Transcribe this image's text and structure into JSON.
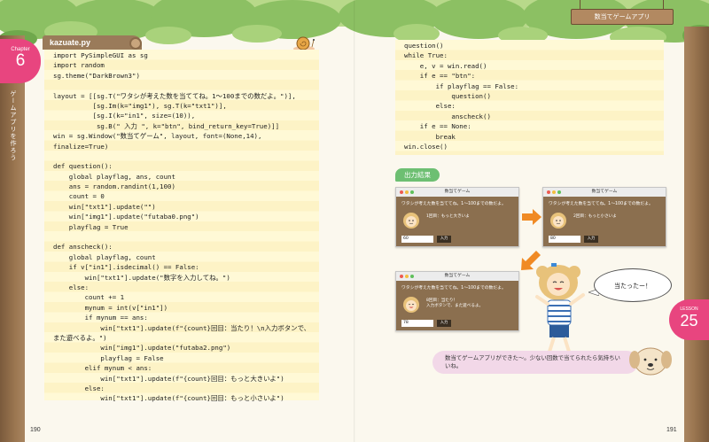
{
  "header": {
    "sign": "数当てゲームアプリ"
  },
  "chapter": {
    "word": "Chapter",
    "number": "6",
    "vertical": "ゲームアプリを作ろう"
  },
  "lesson": {
    "word": "LESSON",
    "number": "25"
  },
  "listing": {
    "filename": "kazuate.py",
    "left_lines": [
      "import PySimpleGUI as sg",
      "import random",
      "sg.theme(\"DarkBrown3\")",
      "",
      "layout = [[sg.T(\"ワタシが考えた数を当ててね。1〜100までの数だよ。\")],",
      "          [sg.Im(k=\"img1\"), sg.T(k=\"txt1\")],",
      "          [sg.I(k=\"in1\", size=(10)),",
      "           sg.B(\" 入力 \", k=\"btn\", bind_return_key=True)]]",
      "win = sg.Window(\"数当てゲーム\", layout, font=(None,14),",
      "finalize=True)",
      "",
      "def question():",
      "    global playflag, ans, count",
      "    ans = random.randint(1,100)",
      "    count = 0",
      "    win[\"txt1\"].update(\"\")",
      "    win[\"img1\"].update(\"futaba0.png\")",
      "    playflag = True",
      "",
      "def anscheck():",
      "    global playflag, count",
      "    if v[\"in1\"].isdecimal() == False:",
      "        win[\"txt1\"].update(\"数字を入力してね。\")",
      "    else:",
      "        count += 1",
      "        mynum = int(v[\"in1\"])",
      "        if mynum == ans:",
      "            win[\"txt1\"].update(f\"{count}回目：当たり！\\n入力ボタンで、",
      "また遊べるよ。\")",
      "            win[\"img1\"].update(\"futaba2.png\")",
      "            playflag = False",
      "        elif mynum < ans:",
      "            win[\"txt1\"].update(f\"{count}回目：もっと大きいよ\")",
      "        else:",
      "            win[\"txt1\"].update(f\"{count}回目：もっと小さいよ\")"
    ],
    "right_lines": [
      "question()",
      "while True:",
      "    e, v = win.read()",
      "    if e == \"btn\":",
      "        if playflag == False:",
      "            question()",
      "        else:",
      "            anscheck()",
      "    if e == None:",
      "        break",
      "win.close()"
    ]
  },
  "pages": {
    "left": "190",
    "right": "191"
  },
  "output": {
    "label": "出力結果",
    "windows": [
      {
        "title": "数当てゲーム",
        "prompt": "ワタシが考えた数を当ててね。1〜100までの数だよ。",
        "message": "1回目：もっと大きいよ",
        "input": "60",
        "button": "入力"
      },
      {
        "title": "数当てゲーム",
        "prompt": "ワタシが考えた数を当ててね。1〜100までの数だよ。",
        "message": "2回目：もっと小さいよ",
        "input": "80",
        "button": "入力"
      },
      {
        "title": "数当てゲーム",
        "prompt": "ワタシが考えた数を当ててね。1〜100までの数だよ。",
        "message": "8回目：当たり！\n入力ボタンで、また遊べるよ。",
        "input": "78",
        "button": "入力"
      }
    ]
  },
  "speech": "当たったー！",
  "comment": "数当てゲームアプリができた〜。少ない回数で当てられたら気持ちいいね。",
  "colors": {
    "accent": "#e8457f",
    "code_bg": "#fff9d6",
    "app_bg": "#8b6f4f",
    "output_label": "#6dbf72"
  }
}
